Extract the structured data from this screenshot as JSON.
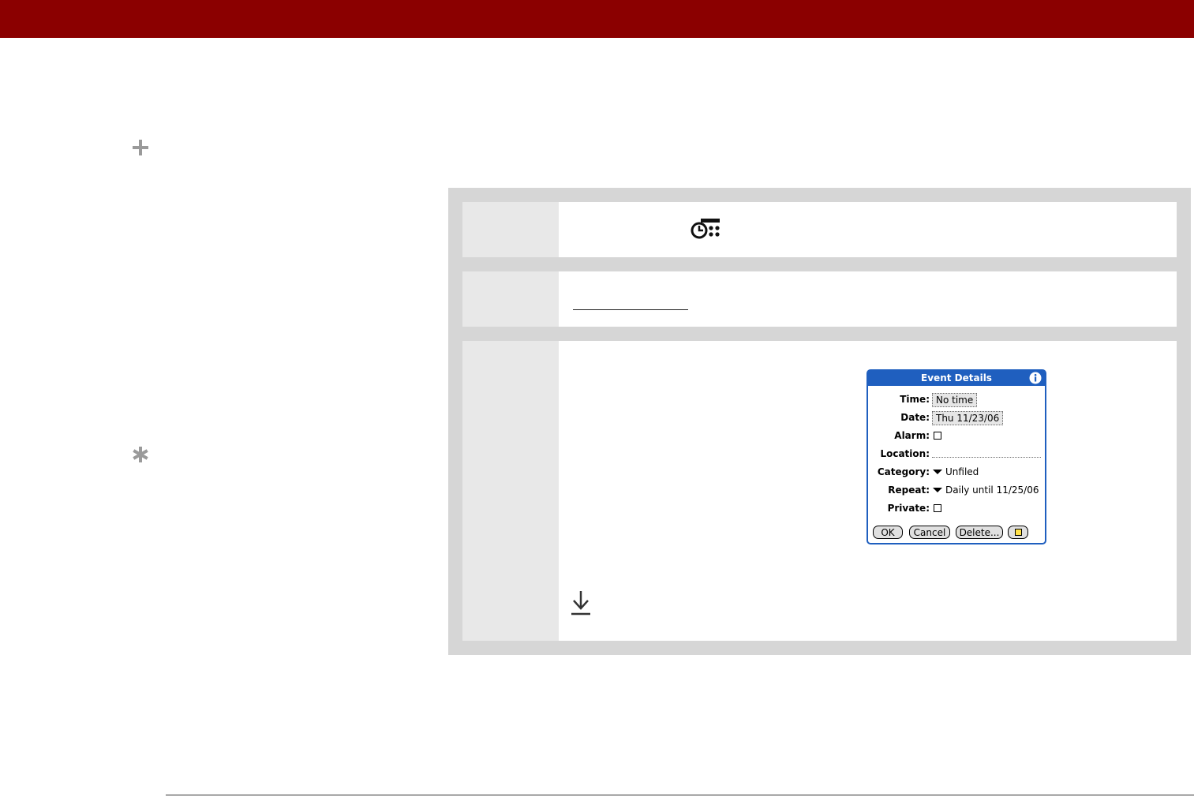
{
  "colors": {
    "header_bar": "#8b0000",
    "panel_bg": "#d6d6d6",
    "step_number_bg": "#e8e8e8",
    "dialog_accent": "#1f5fbf"
  },
  "icons": {
    "margin_top": "plus-icon",
    "margin_bottom": "asterisk-icon",
    "step1": "clock-application-icon",
    "step3": "download-arrow-icon"
  },
  "dialog": {
    "title": "Event Details",
    "fields": [
      {
        "label": "Time:",
        "value": "No time",
        "kind": "box"
      },
      {
        "label": "Date:",
        "value": "Thu 11/23/06",
        "kind": "box"
      },
      {
        "label": "Alarm:",
        "value": "",
        "kind": "checkbox"
      },
      {
        "label": "Location:",
        "value": "",
        "kind": "line"
      },
      {
        "label": "Category:",
        "value": "Unfiled",
        "kind": "dropdown"
      },
      {
        "label": "Repeat:",
        "value": "Daily until 11/25/06",
        "kind": "dropdown"
      },
      {
        "label": "Private:",
        "value": "",
        "kind": "checkbox"
      }
    ],
    "buttons": {
      "ok": "OK",
      "cancel": "Cancel",
      "delete": "Delete..."
    }
  }
}
